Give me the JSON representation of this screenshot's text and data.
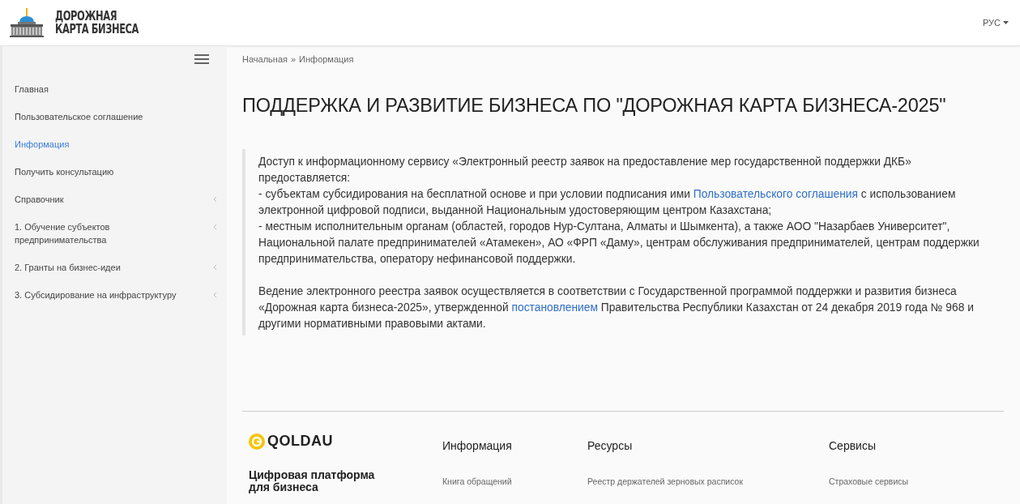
{
  "header": {
    "logo_text": [
      "ДОРОЖНАЯ",
      "КАРТА БИЗНЕСА"
    ],
    "language": "РУС"
  },
  "sidebar": {
    "items": [
      {
        "label": "Главная",
        "selected": false,
        "submenu": false
      },
      {
        "label": "Пользовательское соглашение",
        "selected": false,
        "submenu": false
      },
      {
        "label": "Информация",
        "selected": true,
        "submenu": false
      },
      {
        "label": "Получить консультацию",
        "selected": false,
        "submenu": false
      },
      {
        "label": "Справочник",
        "selected": false,
        "submenu": true
      },
      {
        "label": "1. Обучение субъектов предпринимательства",
        "selected": false,
        "submenu": true
      },
      {
        "label": "2. Гранты на бизнес-идеи",
        "selected": false,
        "submenu": true
      },
      {
        "label": "3. Субсидирование на инфраструктуру",
        "selected": false,
        "submenu": true
      }
    ]
  },
  "breadcrumb": [
    "Начальная",
    "»",
    "Информация"
  ],
  "title": "ПОДДЕРЖКА И РАЗВИТИЕ БИЗНЕСА ПО \"ДОРОЖНАЯ КАРТА БИЗНЕСА-2025\"",
  "paragraphs": [
    {
      "lines": [
        {
          "text": "Доступ к информационному сервису «Электронный реестр заявок на предоставление мер государственной поддержки ДКБ» предоставляется:"
        },
        {
          "text": "- субъектам субсидирования на бесплатной основе и при условии подписания ими ",
          "link": "Пользовательского соглашения",
          "after": " с использованием электронной цифровой подписи, выданной Национальным удостоверяющим центром Казахстана;"
        },
        {
          "text": "- местным исполнительным органам (областей, городов Нур-Султана, Алматы и Шымкента), а также АОО \"Назарбаев Университет\", Национальной палате предпринимателей «Атамекен», АО «ФРП «Даму», центрам обслуживания предпринимателей, центрам поддержки предпринимательства, оператору нефинансовой поддержки."
        }
      ]
    },
    {
      "lines": [
        {
          "text": "Ведение электронного реестра заявок осуществляется в соответствии с Государственной программой поддержки и развития бизнеса «Дорожная карта бизнеса-2025», утвержденной ",
          "link": "постановлением",
          "after": " Правительства Республики Казахстан от 24 декабря 2019 года № 968 и другими нормативными правовыми актами."
        }
      ]
    }
  ],
  "footer": {
    "brand": "QOLDAU",
    "tagline": "Цифровая платформа для бизнеса",
    "columns": [
      {
        "heading": "Информация",
        "links": [
          "Книга обращений"
        ]
      },
      {
        "heading": "Ресурсы",
        "links": [
          "Реестр держателей зерновых расписок"
        ]
      },
      {
        "heading": "Сервисы",
        "links": [
          "Страховые сервисы"
        ]
      }
    ]
  }
}
